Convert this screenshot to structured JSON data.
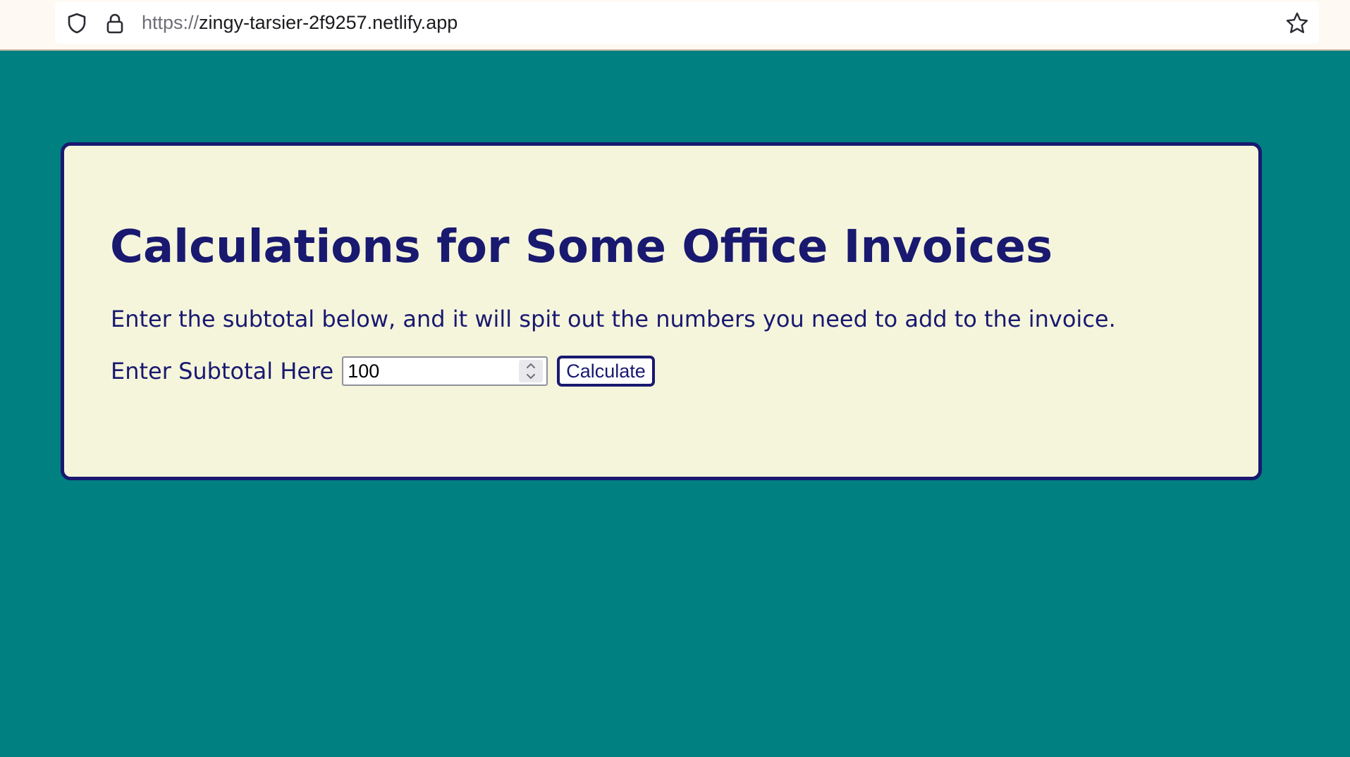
{
  "browser": {
    "url_scheme": "https://",
    "url_host": "zingy-tarsier-2f9257.netlify.app",
    "icons": [
      "shield-icon",
      "lock-icon",
      "star-icon"
    ]
  },
  "page": {
    "background_color": "#008080",
    "card_color": "#f5f5dc",
    "accent_color": "#191970",
    "title": "Calculations for Some Office Invoices",
    "intro": "Enter the subtotal below, and it will spit out the numbers you need to add to the invoice.",
    "form": {
      "label": "Enter Subtotal Here",
      "subtotal_value": "100",
      "button_label": "Calculate"
    }
  }
}
